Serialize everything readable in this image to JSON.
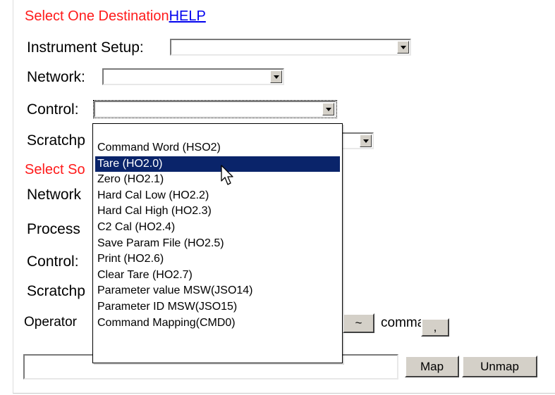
{
  "section1": {
    "heading": "Select One Destination",
    "help_link": "HELP",
    "instrument_setup_label": "Instrument Setup:",
    "network_label": "Network:",
    "control_label": "Control:",
    "scratchpad_label": "Scratchp"
  },
  "section2": {
    "heading": "Select So",
    "network_label": "Network",
    "process_label": "Process",
    "control_label": "Control:",
    "scratchpad_label": "Scratchp",
    "operator_label": "Operator"
  },
  "buttons": {
    "tilde": "~",
    "comma_label": "comma",
    "comma_btn": ",",
    "map": "Map",
    "unmap": "Unmap"
  },
  "control_dropdown": {
    "selected_index": 1,
    "options": [
      "Command Word (HSO2)",
      "Tare (HO2.0)",
      "Zero (HO2.1)",
      "Hard Cal Low (HO2.2)",
      "Hard Cal High (HO2.3)",
      "C2 Cal (HO2.4)",
      "Save Param File (HO2.5)",
      "Print (HO2.6)",
      "Clear Tare (HO2.7)",
      "Parameter value MSW(JSO14)",
      "Parameter ID MSW(JSO15)",
      "Command Mapping(CMD0)"
    ]
  },
  "colors": {
    "heading": "#ff1a1a",
    "link": "#0000ee",
    "selection": "#0a246a"
  }
}
